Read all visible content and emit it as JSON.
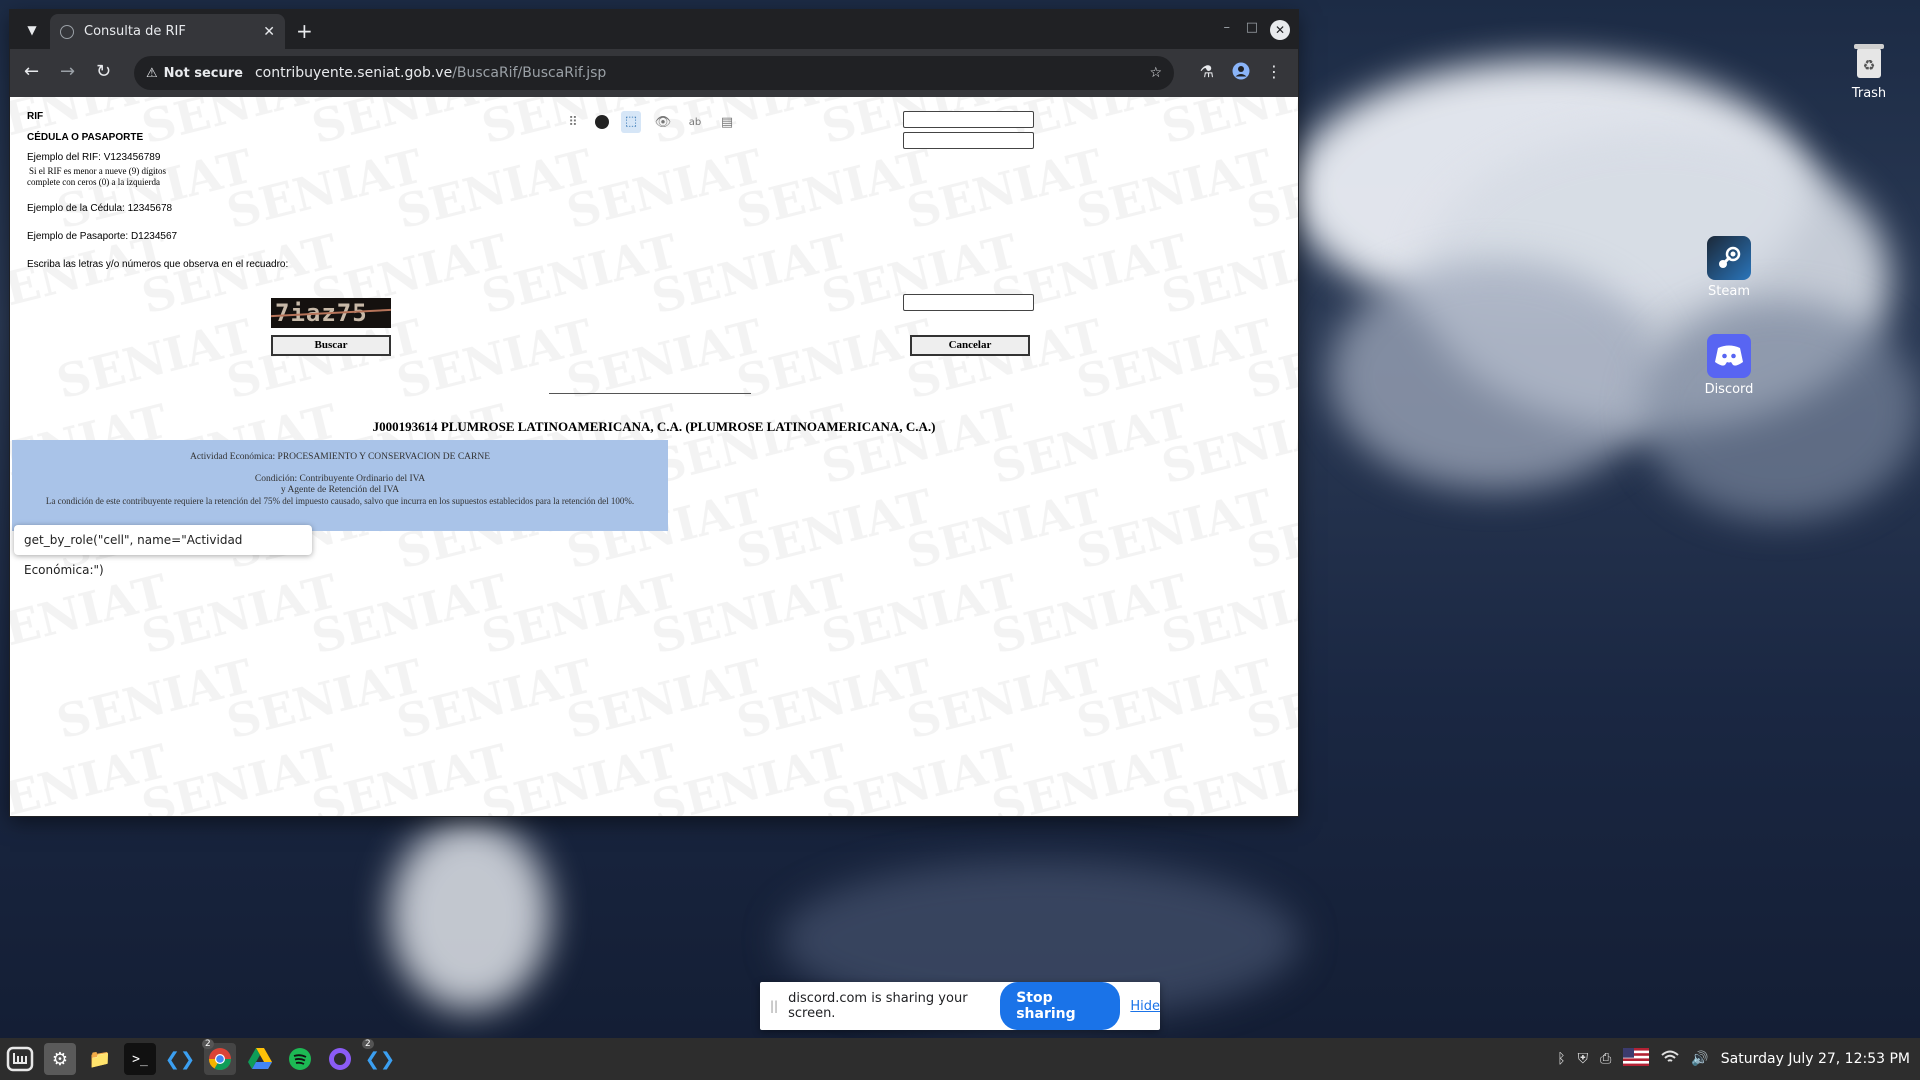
{
  "desktop": {
    "icons": [
      {
        "label": "Trash",
        "icon": "trash-icon"
      },
      {
        "label": "Steam",
        "icon": "steam-icon"
      },
      {
        "label": "Discord",
        "icon": "discord-icon"
      }
    ]
  },
  "browser": {
    "tab_title": "Consulta de RIF",
    "security_label": "Not secure",
    "url_domain": "contribuyente.seniat.gob.ve",
    "url_path": "/BuscaRif/BuscaRif.jsp"
  },
  "page": {
    "watermark": "SENIAT",
    "rif_label": "RIF",
    "cedula_label": "CÉDULA O PASAPORTE",
    "rif_example": "Ejemplo del RIF: V123456789",
    "rif_note_1": "Si el RIF es menor a nueve (9) dígitos",
    "rif_note_2": "complete con ceros (0) a la izquierda",
    "cedula_example": "Ejemplo de la Cédula: 12345678",
    "pasaporte_example": "Ejemplo de Pasaporte: D1234567",
    "captcha_prompt": "Escriba las letras y/o números que observa en el recuadro:",
    "captcha_text": "7iaz75",
    "buscar_label": "Buscar",
    "cancelar_label": "Cancelar",
    "company_title": "J000193614 PLUMROSE LATINOAMERICANA, C.A. (PLUMROSE LATINOAMERICANA, C.A.)",
    "actividad": "Actividad Económica: PROCESAMIENTO Y CONSERVACION DE CARNE",
    "condicion_1": "Condición: Contribuyente Ordinario del IVA",
    "condicion_2": "y Agente de Retención del IVA",
    "retencion_note": "La condición de este contribuyente requiere la retención del 75% del impuesto causado, salvo que incurra en los supuestos establecidos para la retención del 100%.",
    "tooltip": "get_by_role(\"cell\", name=\"Actividad Económica:\")"
  },
  "sharebar": {
    "message": "discord.com is sharing your screen.",
    "stop_label": "Stop sharing",
    "hide_label": "Hide"
  },
  "taskbar": {
    "clock": "Saturday July 27, 12:53 PM",
    "badge_chrome": "2",
    "badge_vscode": "2"
  }
}
